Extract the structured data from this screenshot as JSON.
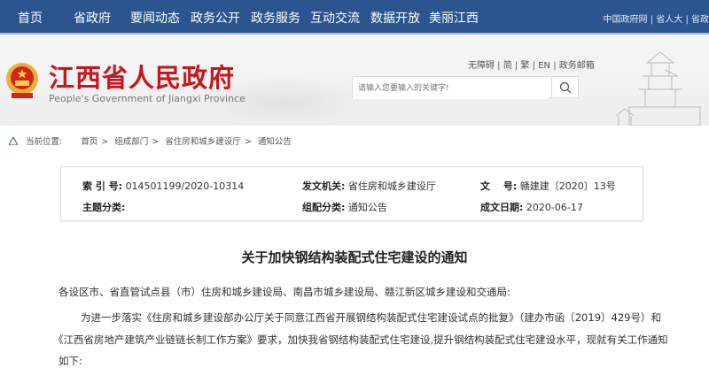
{
  "nav": {
    "items": [
      "首页",
      "省政府",
      "要闻动态",
      "政务公开",
      "政务服务",
      "互动交流",
      "数据开放",
      "美丽江西"
    ],
    "top_links": [
      "中国政府网",
      "省人大",
      "省政"
    ]
  },
  "header": {
    "title": "江西省人民政府",
    "subtitle": "People's Government of Jiangxi Province",
    "links": [
      "无障碍",
      "简",
      "繁",
      "EN",
      "政务邮箱"
    ],
    "search_placeholder": "请输入您要输入的关键字!",
    "brand_color": "#c8161d",
    "nav_color": "#2c5590"
  },
  "breadcrumb": {
    "label": "当前位置:",
    "items": [
      "首页",
      "组成部门",
      "省住房和城乡建设厅",
      "通知公告"
    ]
  },
  "info": {
    "index_label": "索 引 号:",
    "index": "014501199/2020-10314",
    "issuer_label": "发文机关:",
    "issuer": "省住房和城乡建设厅",
    "docno_label": "文　 号:",
    "docno": "赣建建〔2020〕13号",
    "topic_label": "主题分类:",
    "topic": "",
    "category_label": "组配分类:",
    "category": "通知公告",
    "date_label": "成文日期:",
    "date": "2020-06-17"
  },
  "article": {
    "title": "关于加快钢结构装配式住宅建设的通知",
    "salutation": "各设区市、省直管试点县（市）住房和城乡建设局、南昌市城乡建设局、赣江新区城乡建设和交通局:",
    "p1_line1": "为进一步落实《住房和城乡建设部办公厅关于同意江西省开展钢结构装配式住宅建设试点的批复》（建办市函〔2019〕429号）和",
    "p1_line2": "《江西省房地产建筑产业链链长制工作方案》要求，加快我省钢结构装配式住宅建设,提升钢结构装配式住宅建设水平，现就有关工作通知",
    "p1_line3": "如下:"
  }
}
